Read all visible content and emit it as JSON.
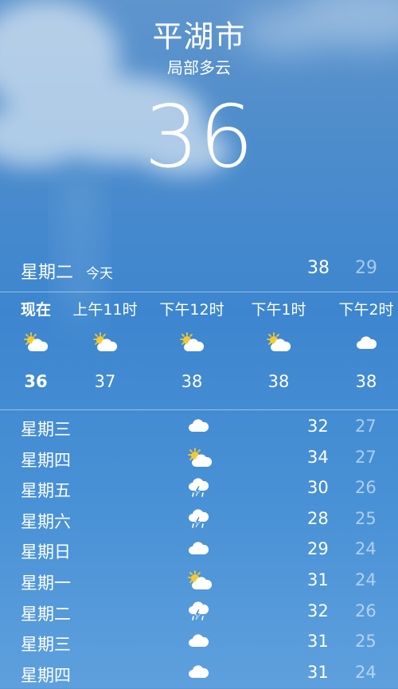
{
  "location": {
    "city": "平湖市",
    "condition": "局部多云",
    "current_temp": "36"
  },
  "today": {
    "day": "星期二",
    "label": "今天",
    "high": "38",
    "low": "29"
  },
  "hourly": [
    {
      "time": "现在",
      "icon": "partly-cloudy-icon",
      "temp": "36"
    },
    {
      "time": "上午11时",
      "icon": "partly-cloudy-icon",
      "temp": "37"
    },
    {
      "time": "下午12时",
      "icon": "partly-cloudy-icon",
      "temp": "38"
    },
    {
      "time": "下午1时",
      "icon": "partly-cloudy-icon",
      "temp": "38"
    },
    {
      "time": "下午2时",
      "icon": "cloud-icon",
      "temp": "38"
    }
  ],
  "daily": [
    {
      "day": "星期三",
      "icon": "cloud-icon",
      "high": "32",
      "low": "27"
    },
    {
      "day": "星期四",
      "icon": "partly-cloudy-icon",
      "high": "34",
      "low": "27"
    },
    {
      "day": "星期五",
      "icon": "thunderstorm-icon",
      "high": "30",
      "low": "26"
    },
    {
      "day": "星期六",
      "icon": "thunderstorm-icon",
      "high": "28",
      "low": "25"
    },
    {
      "day": "星期日",
      "icon": "cloud-icon",
      "high": "29",
      "low": "24"
    },
    {
      "day": "星期一",
      "icon": "partly-cloudy-icon",
      "high": "31",
      "low": "24"
    },
    {
      "day": "星期二",
      "icon": "thunderstorm-icon",
      "high": "32",
      "low": "26"
    },
    {
      "day": "星期三",
      "icon": "cloud-icon",
      "high": "31",
      "low": "25"
    },
    {
      "day": "星期四",
      "icon": "cloud-icon",
      "high": "31",
      "low": "24"
    }
  ]
}
